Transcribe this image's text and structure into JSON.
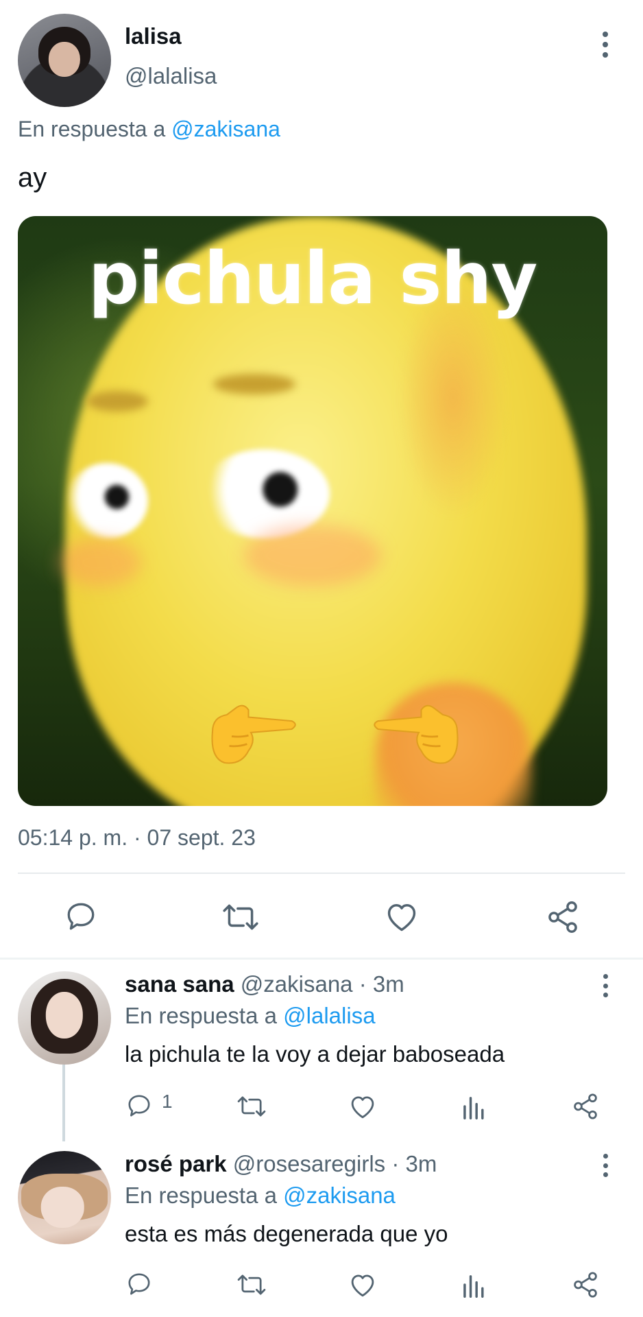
{
  "main_tweet": {
    "author_name": "lalisa",
    "author_handle": "@lalalisa",
    "reply_prefix": "En respuesta a ",
    "reply_to": "@zakisana",
    "text": "ay",
    "media_caption": "pichula shy",
    "timestamp": "05:14 p. m. · 07 sept. 23",
    "actions": [
      "reply-icon",
      "retweet-icon",
      "like-icon",
      "share-icon"
    ]
  },
  "replies": [
    {
      "author_name": "sana sana",
      "author_handle": "@zakisana",
      "time": " · 3m",
      "reply_prefix": "En respuesta a ",
      "reply_to": "@lalalisa",
      "text": "la pichula te la voy a dejar baboseada",
      "reply_count": "1"
    },
    {
      "author_name": "rosé park",
      "author_handle": "@rosesaregirls",
      "time": " · 3m",
      "reply_prefix": "En respuesta a ",
      "reply_to": "@zakisana",
      "text": "esta es más degenerada que yo",
      "reply_count": ""
    }
  ],
  "colors": {
    "link": "#1d9bf0",
    "secondary_text": "#536471",
    "primary_text": "#0f1419",
    "divider": "#eff3f4"
  }
}
